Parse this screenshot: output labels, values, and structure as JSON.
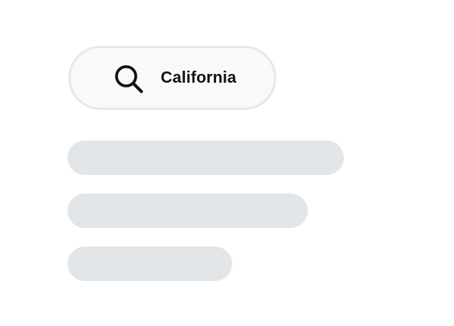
{
  "search": {
    "query": "California",
    "icon": "search-icon"
  },
  "results": {
    "state": "loading",
    "placeholder_rows": 3
  },
  "colors": {
    "background": "#ffffff",
    "pill_background": "#f8f9f8",
    "pill_border": "#e6e9e9",
    "skeleton": "#e3e6e8",
    "text": "#111111"
  }
}
